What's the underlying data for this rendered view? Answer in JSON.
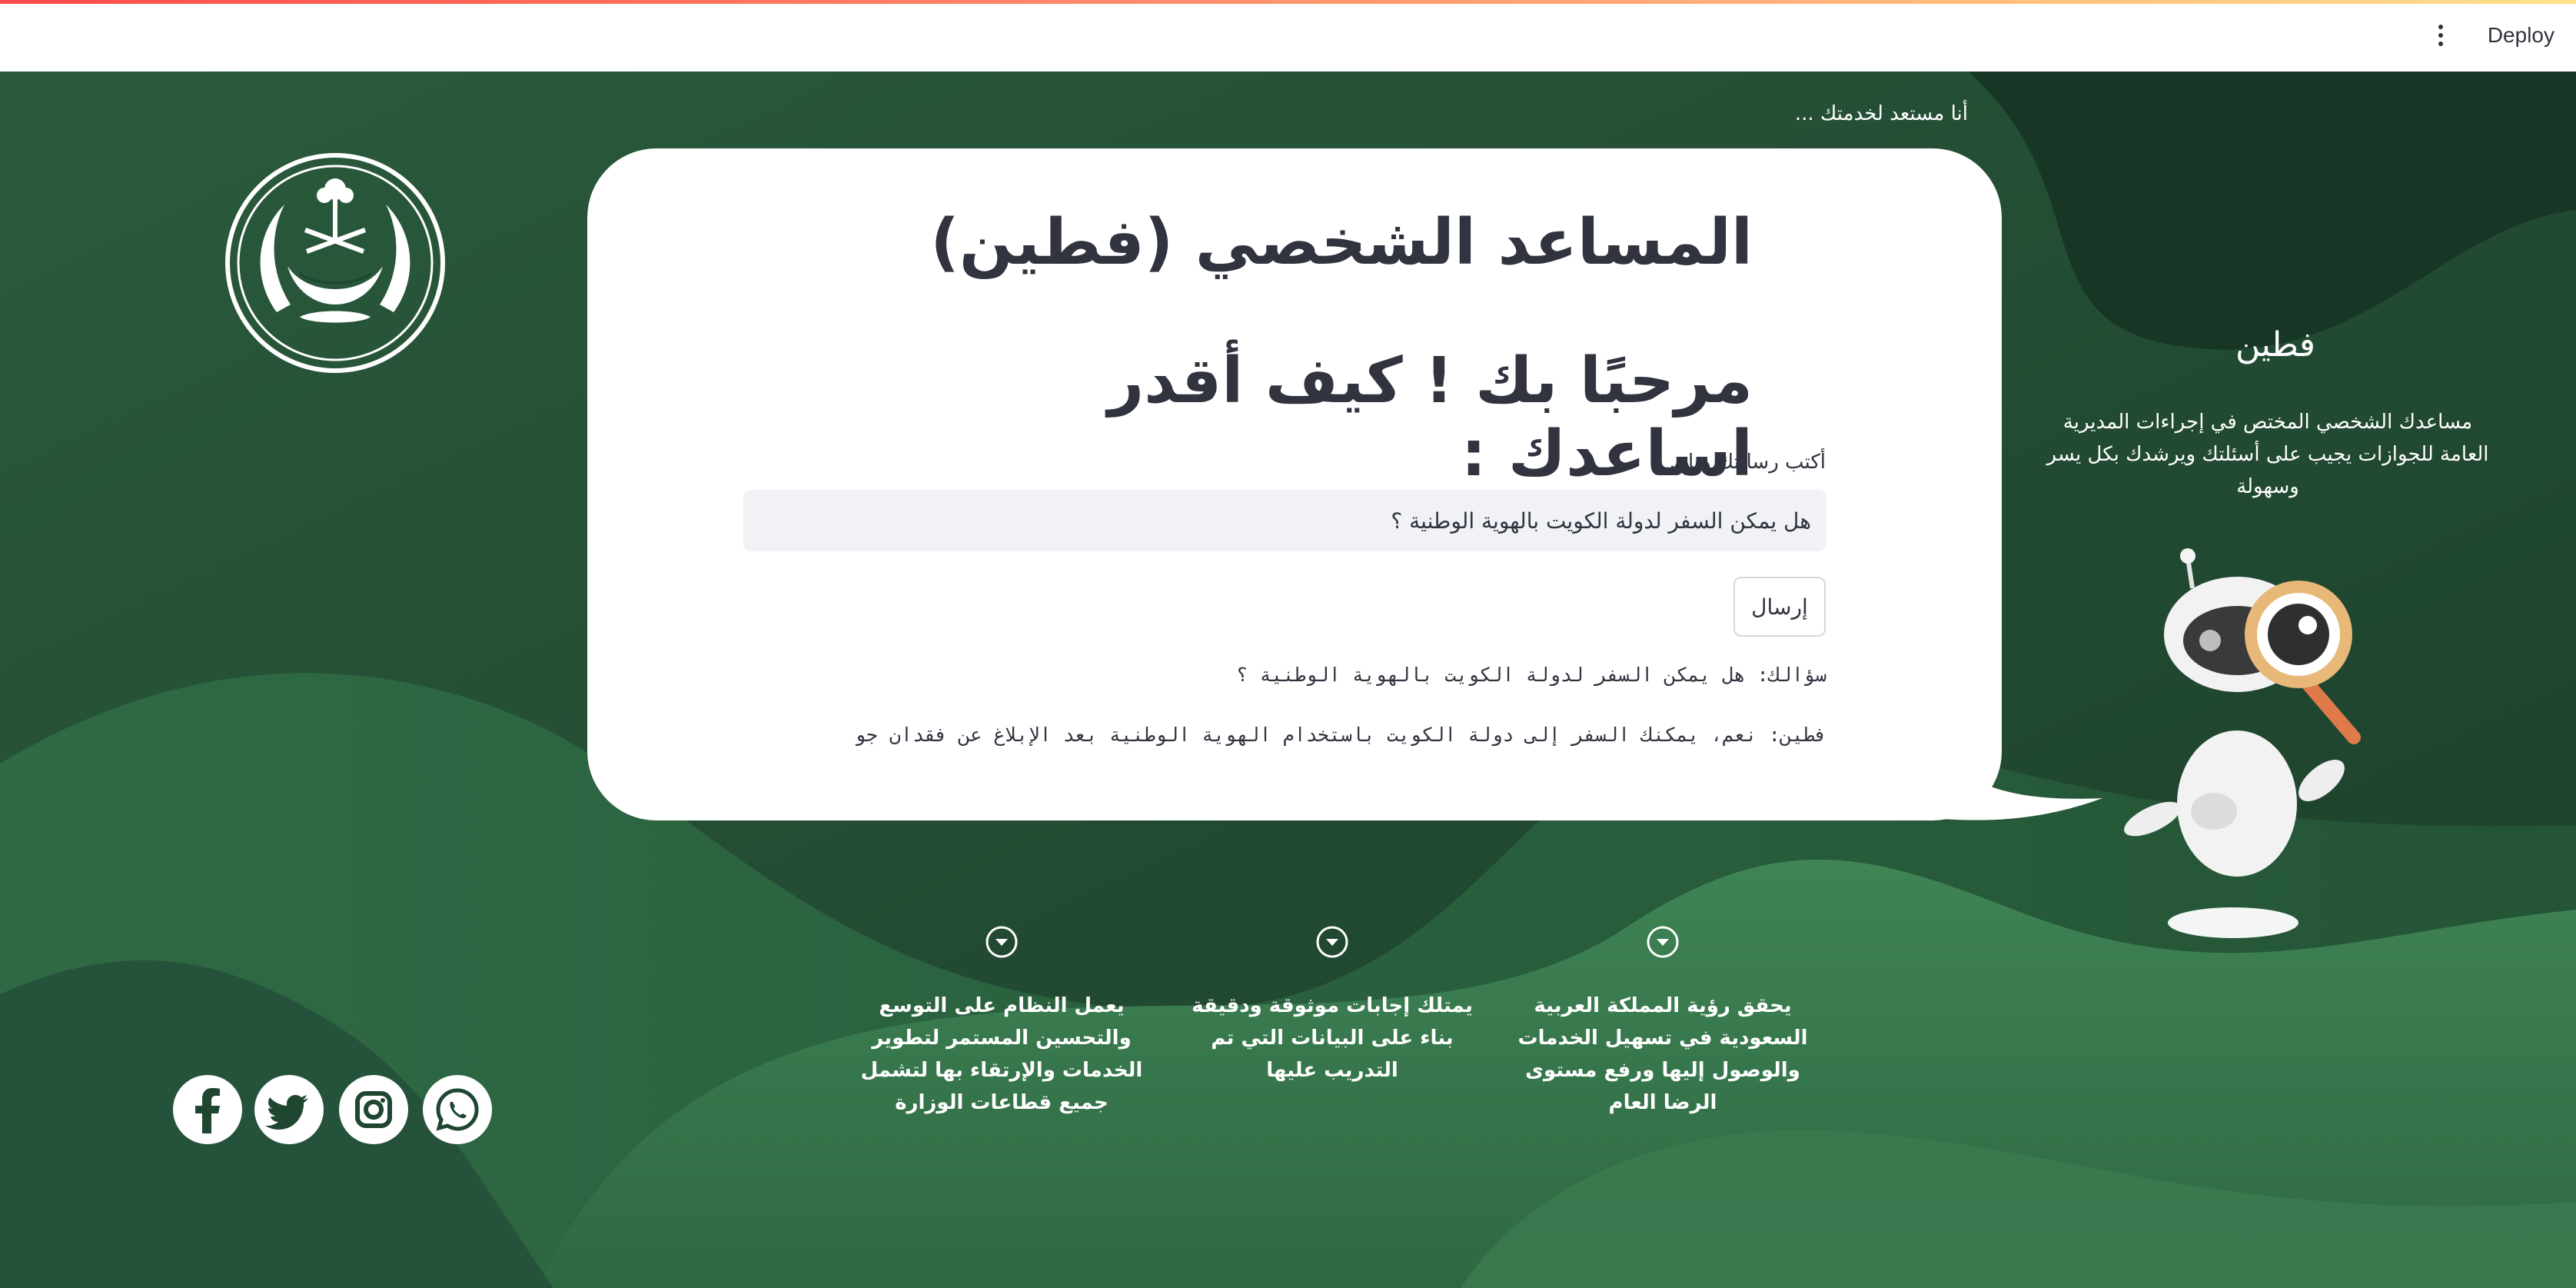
{
  "topbar": {
    "deploy_label": "Deploy",
    "menu_icon": "kebab-menu-icon"
  },
  "header": {
    "ready_text": "أنا مستعد لخدمتك ..."
  },
  "chat": {
    "title": "المساعد الشخصي (فطين)",
    "welcome": "مرحبًا بك ! كيف أقدر اساعدك :",
    "input_label": "أكتب رسالتك هنا...",
    "input_value": "هل يمكن السفر لدولة الكويت بالهوية الوطنية ؟",
    "send_label": "إرسال",
    "question_line": "سؤالك: هل يمكن السفر لدولة الكويت بالهوية الوطنية ؟",
    "answer_line": "فطين: نعم، يمكنك السفر إلى دولة الكويت باستخدام الهوية الوطنية بعد الإبلاغ عن فقدان جو"
  },
  "side": {
    "title": "فطين",
    "description": "مساعدك الشخصي المختص في إجراءات المديرية العامة للجوازات يجيب على أسئلتك ويرشدك بكل يسر وسهولة"
  },
  "features": [
    {
      "text": "يحقق رؤية المملكة العربية السعودية في تسهيل الخدمات والوصول إليها ورفع مستوى الرضا العام",
      "icon": "chevron-down-circle-icon"
    },
    {
      "text": "يمتلك إجابات موثوقة ودقيقة بناء على البيانات التي تم التدريب عليها",
      "icon": "chevron-down-circle-icon"
    },
    {
      "text": "يعمل النظام على التوسع والتحسين المستمر لتطوير الخدمات والإرتقاء بها لتشمل جميع قطاعات الوزارة",
      "icon": "chevron-down-circle-icon"
    }
  ],
  "socials": [
    "facebook-icon",
    "twitter-icon",
    "instagram-icon",
    "whatsapp-icon"
  ],
  "colors": {
    "background_dark": "#1f4630",
    "background_light": "#3f7f52",
    "text_dark": "#31333f",
    "input_bg": "#f0f2f6"
  }
}
